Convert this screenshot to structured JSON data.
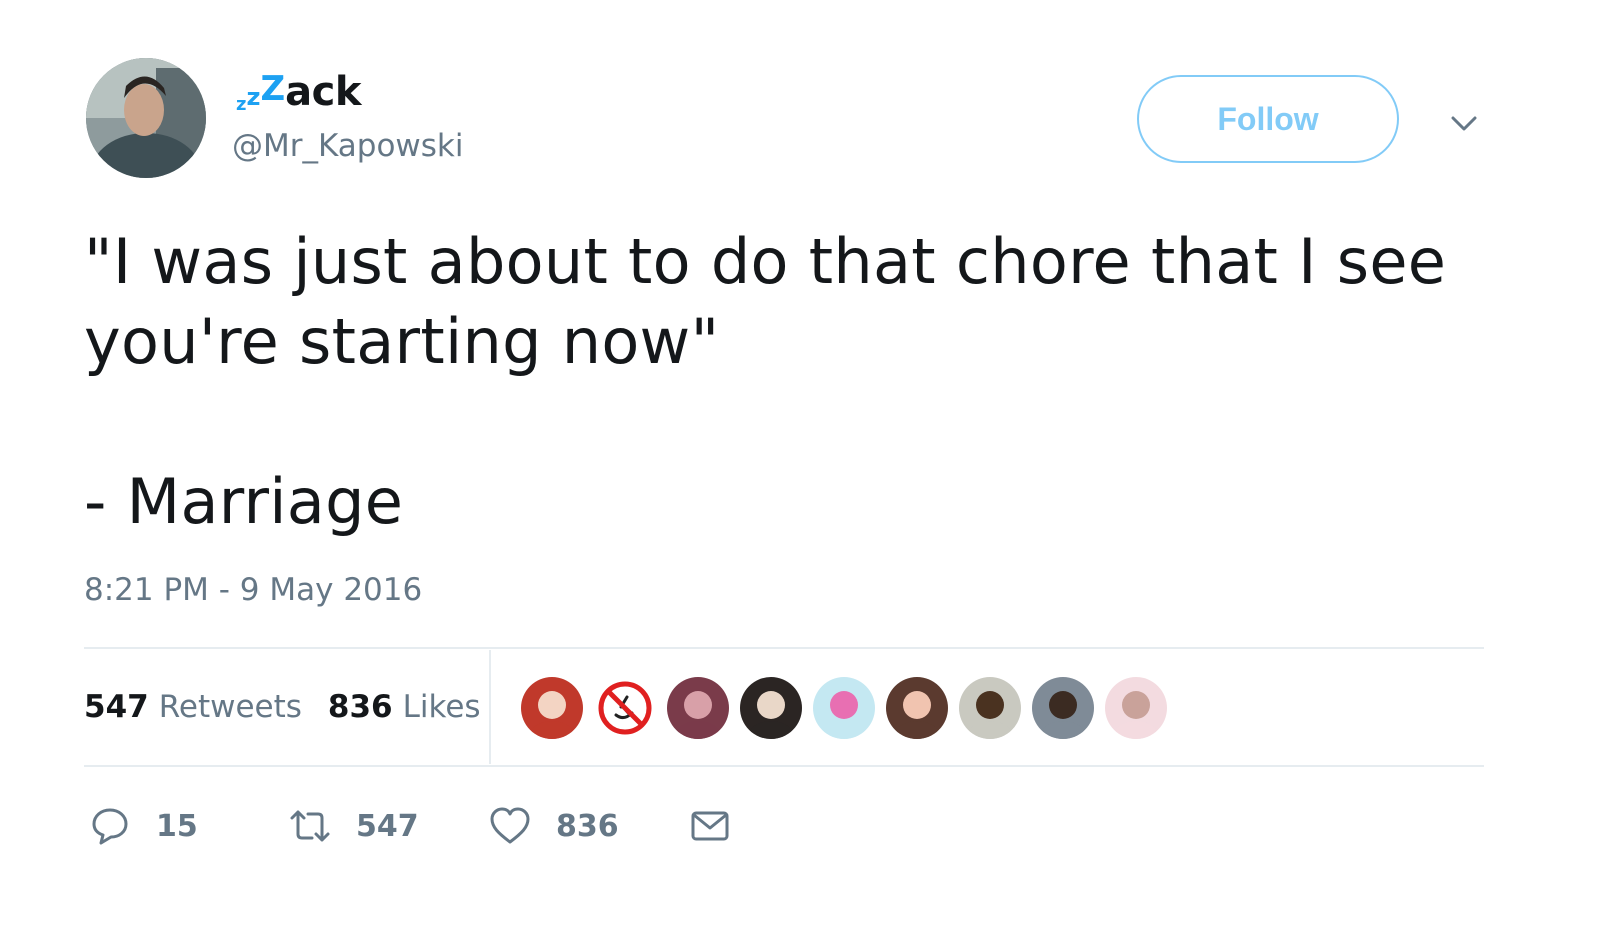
{
  "user": {
    "name_prefix_letters": [
      "z",
      "z",
      "Z"
    ],
    "name_rest": "ack",
    "handle": "@Mr_Kapowski",
    "avatar_icon": "user-avatar"
  },
  "follow_label": "Follow",
  "caret_icon": "chevron-down-icon",
  "tweet": {
    "line1": "\"I was just about to do that chore that I see you're starting now\"",
    "line2": "- Marriage"
  },
  "timestamp": "8:21 PM - 9 May 2016",
  "stats": {
    "retweets_count": "547",
    "retweets_label": "Retweets",
    "likes_count": "836",
    "likes_label": "Likes"
  },
  "likers": [
    {
      "bg": "#c0392b",
      "fg": "#f3d4c3"
    },
    {
      "bg": "#ffffff",
      "fg": "#e02020",
      "icon": "no-hammer-sickle-icon"
    },
    {
      "bg": "#7a3b4a",
      "fg": "#d8a0a8"
    },
    {
      "bg": "#2b2523",
      "fg": "#e9d7c8"
    },
    {
      "bg": "#c4e8f2",
      "fg": "#e86fb2"
    },
    {
      "bg": "#5b3a2f",
      "fg": "#f1c4b0"
    },
    {
      "bg": "#c9c9c0",
      "fg": "#4a3220"
    },
    {
      "bg": "#7f8b97",
      "fg": "#3b2b22"
    },
    {
      "bg": "#f3dbe0",
      "fg": "#c9a29a"
    }
  ],
  "actions": {
    "reply_count": "15",
    "retweet_count": "547",
    "like_count": "836"
  },
  "colors": {
    "accent": "#1da1f2",
    "muted": "#657786",
    "text": "#14171a",
    "divider": "#e6ecf0"
  }
}
